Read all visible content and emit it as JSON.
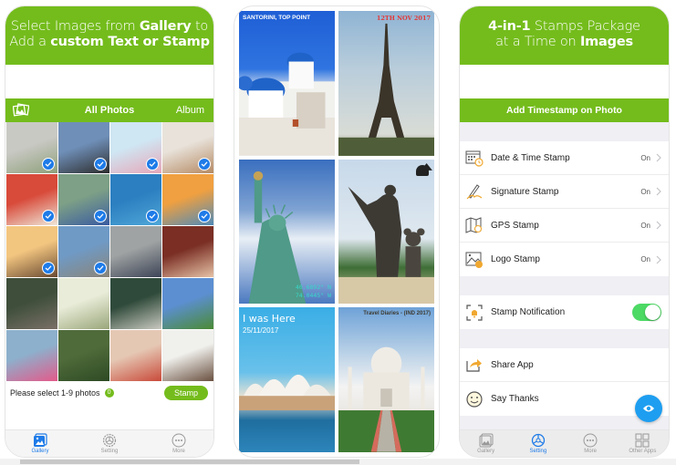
{
  "panel_gallery": {
    "promo": {
      "line1_pre": "Select Images from ",
      "line1_bold": "Gallery",
      "line1_post": " to",
      "line2_pre": "Add a ",
      "line2_bold": "custom Text or Stamp"
    },
    "gallery_bar": {
      "icon": "photos-icon",
      "title": "All Photos",
      "album_label": "Album"
    },
    "photos": [
      {
        "subject": "child walking with adult",
        "selected": true
      },
      {
        "subject": "graduation caps",
        "selected": true
      },
      {
        "subject": "beach wedding aisle",
        "selected": true
      },
      {
        "subject": "girl with dog",
        "selected": true
      },
      {
        "subject": "boy with glasses",
        "selected": true
      },
      {
        "subject": "wedding couple",
        "selected": true
      },
      {
        "subject": "scuba diver",
        "selected": true
      },
      {
        "subject": "surfer at sunset",
        "selected": true
      },
      {
        "subject": "parent lifting child",
        "selected": true
      },
      {
        "subject": "skydivers",
        "selected": true
      },
      {
        "subject": "group at castle",
        "selected": false
      },
      {
        "subject": "baby in santa hat",
        "selected": false
      },
      {
        "subject": "woman in coat",
        "selected": false
      },
      {
        "subject": "friends group",
        "selected": false
      },
      {
        "subject": "family in frame",
        "selected": false
      },
      {
        "subject": "football team",
        "selected": false
      },
      {
        "subject": "girl on swing set",
        "selected": false
      },
      {
        "subject": "toddler on swing",
        "selected": false
      },
      {
        "subject": "child drawing",
        "selected": false
      },
      {
        "subject": "child on slide",
        "selected": false
      }
    ],
    "selection": {
      "hint": "Please select 1-9 photos",
      "count": "0",
      "stamp_button": "Stamp"
    },
    "tabs": [
      {
        "label": "Gallery",
        "icon": "gallery-icon",
        "active": true
      },
      {
        "label": "Setting",
        "icon": "settings-wheel-icon",
        "active": false
      },
      {
        "label": "More",
        "icon": "more-icon",
        "active": false
      }
    ]
  },
  "panel_collage": {
    "tiles": [
      {
        "subject": "Santorini blue domes",
        "caption": "SANTORINI, TOP POINT"
      },
      {
        "subject": "Eiffel Tower",
        "caption": "12TH NOV 2017"
      },
      {
        "subject": "Statue of Liberty",
        "caption_line1": "40.6892° N",
        "caption_line2": "74.0445° W"
      },
      {
        "subject": "Walt and Mickey statue",
        "caption": "Adventure Studios logo"
      },
      {
        "subject": "Sydney Opera House",
        "caption_line1": "I was Here",
        "caption_line2": "25/11/2017"
      },
      {
        "subject": "Taj Mahal",
        "caption": "Travel Diaries - (IND 2017)"
      }
    ]
  },
  "panel_settings": {
    "promo": {
      "line1_bold": "4-in-1",
      "line1_post": " Stamps Package",
      "line2_pre": "at a Time on ",
      "line2_bold": "Images"
    },
    "section_title": "Add Timestamp on Photo",
    "stamps": [
      {
        "label": "Date & Time Stamp",
        "value": "On",
        "icon": "calendar-clock-icon"
      },
      {
        "label": "Signature Stamp",
        "value": "On",
        "icon": "pen-signature-icon"
      },
      {
        "label": "GPS Stamp",
        "value": "On",
        "icon": "map-icon"
      },
      {
        "label": "Logo Stamp",
        "value": "On",
        "icon": "image-logo-icon"
      }
    ],
    "notification": {
      "label": "Stamp Notification",
      "enabled": true,
      "icon": "bell-frame-icon"
    },
    "actions": [
      {
        "label": "Share App",
        "icon": "share-icon"
      },
      {
        "label": "Say Thanks",
        "icon": "smiley-icon"
      }
    ],
    "fab_icon": "eye-icon",
    "tabs": [
      {
        "label": "Gallery",
        "icon": "gallery-icon",
        "active": false
      },
      {
        "label": "Setting",
        "icon": "settings-wheel-icon",
        "active": true
      },
      {
        "label": "More",
        "icon": "more-icon",
        "active": false
      },
      {
        "label": "Other Apps",
        "icon": "grid-apps-icon",
        "active": false
      }
    ]
  },
  "colors": {
    "brand_green": "#74bc1c",
    "accent_blue": "#1e7be8",
    "toggle_green": "#4cd964",
    "fab_blue": "#1e9ef0",
    "icon_orange": "#f0a830"
  }
}
